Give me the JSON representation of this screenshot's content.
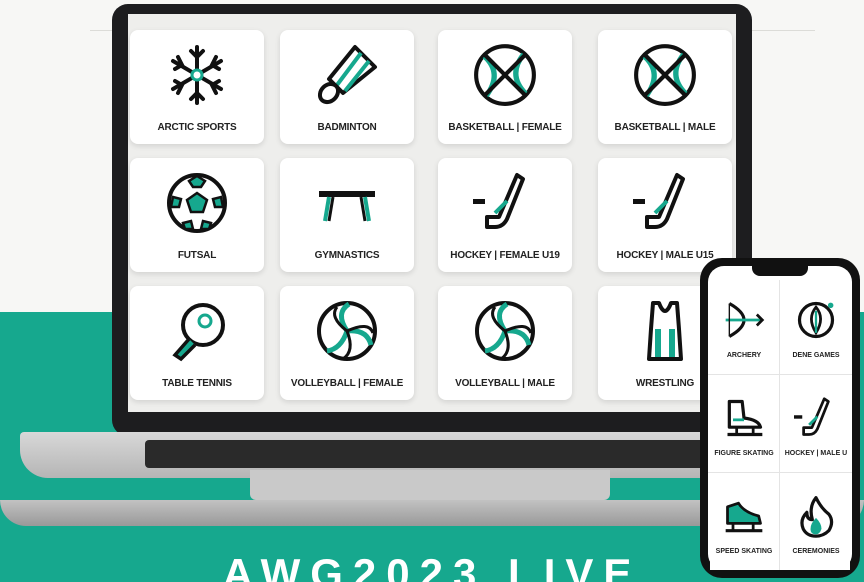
{
  "banner": {
    "text": "AWG2023 LIVE"
  },
  "colors": {
    "accent": "#16a88e",
    "ink": "#111111"
  },
  "laptop": {
    "tiles": [
      {
        "label": "ARCTIC SPORTS",
        "icon": "snowflake-icon"
      },
      {
        "label": "BADMINTON",
        "icon": "shuttlecock-icon"
      },
      {
        "label": "BASKETBALL | FEMALE",
        "icon": "basketball-icon"
      },
      {
        "label": "BASKETBALL | MALE",
        "icon": "basketball-icon"
      },
      {
        "label": "FUTSAL",
        "icon": "soccer-ball-icon"
      },
      {
        "label": "GYMNASTICS",
        "icon": "balance-beam-icon"
      },
      {
        "label": "HOCKEY | FEMALE U19",
        "icon": "hockey-stick-icon"
      },
      {
        "label": "HOCKEY | MALE U15",
        "icon": "hockey-stick-icon"
      },
      {
        "label": "TABLE TENNIS",
        "icon": "paddle-icon"
      },
      {
        "label": "VOLLEYBALL | FEMALE",
        "icon": "volleyball-icon"
      },
      {
        "label": "VOLLEYBALL | MALE",
        "icon": "volleyball-icon"
      },
      {
        "label": "WRESTLING",
        "icon": "singlet-icon"
      }
    ]
  },
  "phone": {
    "tiles": [
      {
        "label": "ARCHERY",
        "icon": "bow-arrow-icon"
      },
      {
        "label": "DENE GAMES",
        "icon": "feather-icon"
      },
      {
        "label": "FIGURE SKATING",
        "icon": "ice-skate-icon"
      },
      {
        "label": "HOCKEY | MALE U",
        "icon": "hockey-stick-icon"
      },
      {
        "label": "SPEED SKATING",
        "icon": "speed-skate-icon"
      },
      {
        "label": "CEREMONIES",
        "icon": "flame-icon"
      }
    ]
  }
}
